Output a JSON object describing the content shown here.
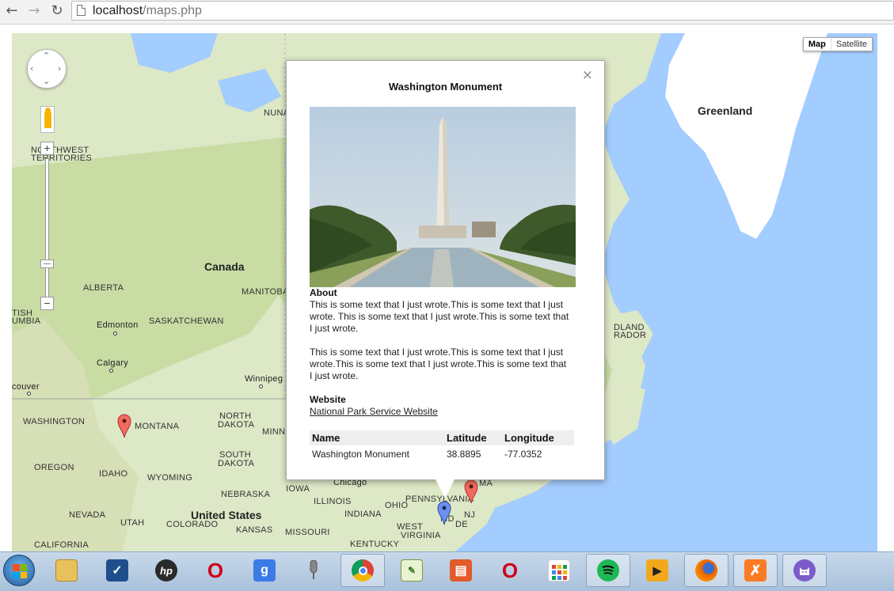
{
  "browser": {
    "url_host": "localhost",
    "url_path": "/maps.php",
    "back_icon": "arrow-left-icon",
    "forward_icon": "arrow-right-icon",
    "reload_icon": "reload-icon"
  },
  "map": {
    "type_control": {
      "map_label": "Map",
      "satellite_label": "Satellite",
      "selected": "Map"
    },
    "labels": {
      "greenland": "Greenland",
      "canada": "Canada",
      "united_states": "United States",
      "nunavut": "NUNA",
      "northwest": "NORTHWEST",
      "territories": "TERRITORIES",
      "alberta": "ALBERTA",
      "british_columbia_a": "TISH",
      "british_columbia_b": "UMBIA",
      "saskatchewan": "SASKATCHEWAN",
      "manitoba": "MANITOBA",
      "edmonton": "Edmonton",
      "calgary": "Calgary",
      "vancouver": "couver",
      "winnipeg": "Winnipeg",
      "washington": "WASHINGTON",
      "montana": "MONTANA",
      "north_dakota_a": "NORTH",
      "north_dakota_b": "DAKOTA",
      "minnesota": "MINN",
      "south_dakota_a": "SOUTH",
      "south_dakota_b": "DAKOTA",
      "oregon": "OREGON",
      "idaho": "IDAHO",
      "wyoming": "WYOMING",
      "nebraska": "NEBRASKA",
      "iowa": "IOWA",
      "illinois": "ILLINOIS",
      "ohio": "OHIO",
      "pennsylvania": "PENNSYLVANIA",
      "chicago": "Chicago",
      "nevada": "NEVADA",
      "utah": "UTAH",
      "colorado": "COLORADO",
      "kansas": "KANSAS",
      "missouri": "MISSOURI",
      "indiana": "INDIANA",
      "west_virginia_a": "WEST",
      "virginia": "VIRGINIA",
      "kentucky": "KENTUCKY",
      "california": "CALIFORNIA",
      "nj": "NJ",
      "de": "DE",
      "md": "MD",
      "ma": "MA",
      "newfoundland_a": "DLAND",
      "newfoundland_b": "RADOR"
    },
    "colors": {
      "water": "#a3ccff",
      "land": "#dfe9c8",
      "forest": "#c5dca0",
      "ice": "#ffffff"
    }
  },
  "infowindow": {
    "close_label": "×",
    "title": "Washington Monument",
    "about_heading": "About",
    "about_p1": "This is some text that I just wrote.This is some text that I just wrote. This is some text that I just wrote.This is some text that I just wrote.",
    "about_p2": "This is some text that I just wrote.This is some text that I just wrote.This is some text that I just wrote.This is some text that I just wrote.",
    "website_heading": "Website",
    "website_link": "National Park Service Website",
    "table": {
      "headers": [
        "Name",
        "Latitude",
        "Longitude"
      ],
      "row": [
        "Washington Monument",
        "38.8895",
        "-77.0352"
      ]
    }
  },
  "taskbar": {
    "items": [
      {
        "name": "file-explorer-icon",
        "label": ""
      },
      {
        "name": "task-app-icon",
        "label": ""
      },
      {
        "name": "hp-icon",
        "label": "hp"
      },
      {
        "name": "opera-icon",
        "label": "O"
      },
      {
        "name": "google-icon",
        "label": "g"
      },
      {
        "name": "microphone-icon",
        "label": ""
      },
      {
        "name": "chrome-icon",
        "label": ""
      },
      {
        "name": "notepad-plus-icon",
        "label": ""
      },
      {
        "name": "presentation-app-icon",
        "label": ""
      },
      {
        "name": "opera-icon-2",
        "label": "O"
      },
      {
        "name": "apps-grid-icon",
        "label": ""
      },
      {
        "name": "spotify-icon",
        "label": ""
      },
      {
        "name": "media-player-icon",
        "label": ""
      },
      {
        "name": "firefox-icon",
        "label": ""
      },
      {
        "name": "xampp-icon",
        "label": ""
      },
      {
        "name": "github-cat-icon",
        "label": ""
      }
    ]
  }
}
